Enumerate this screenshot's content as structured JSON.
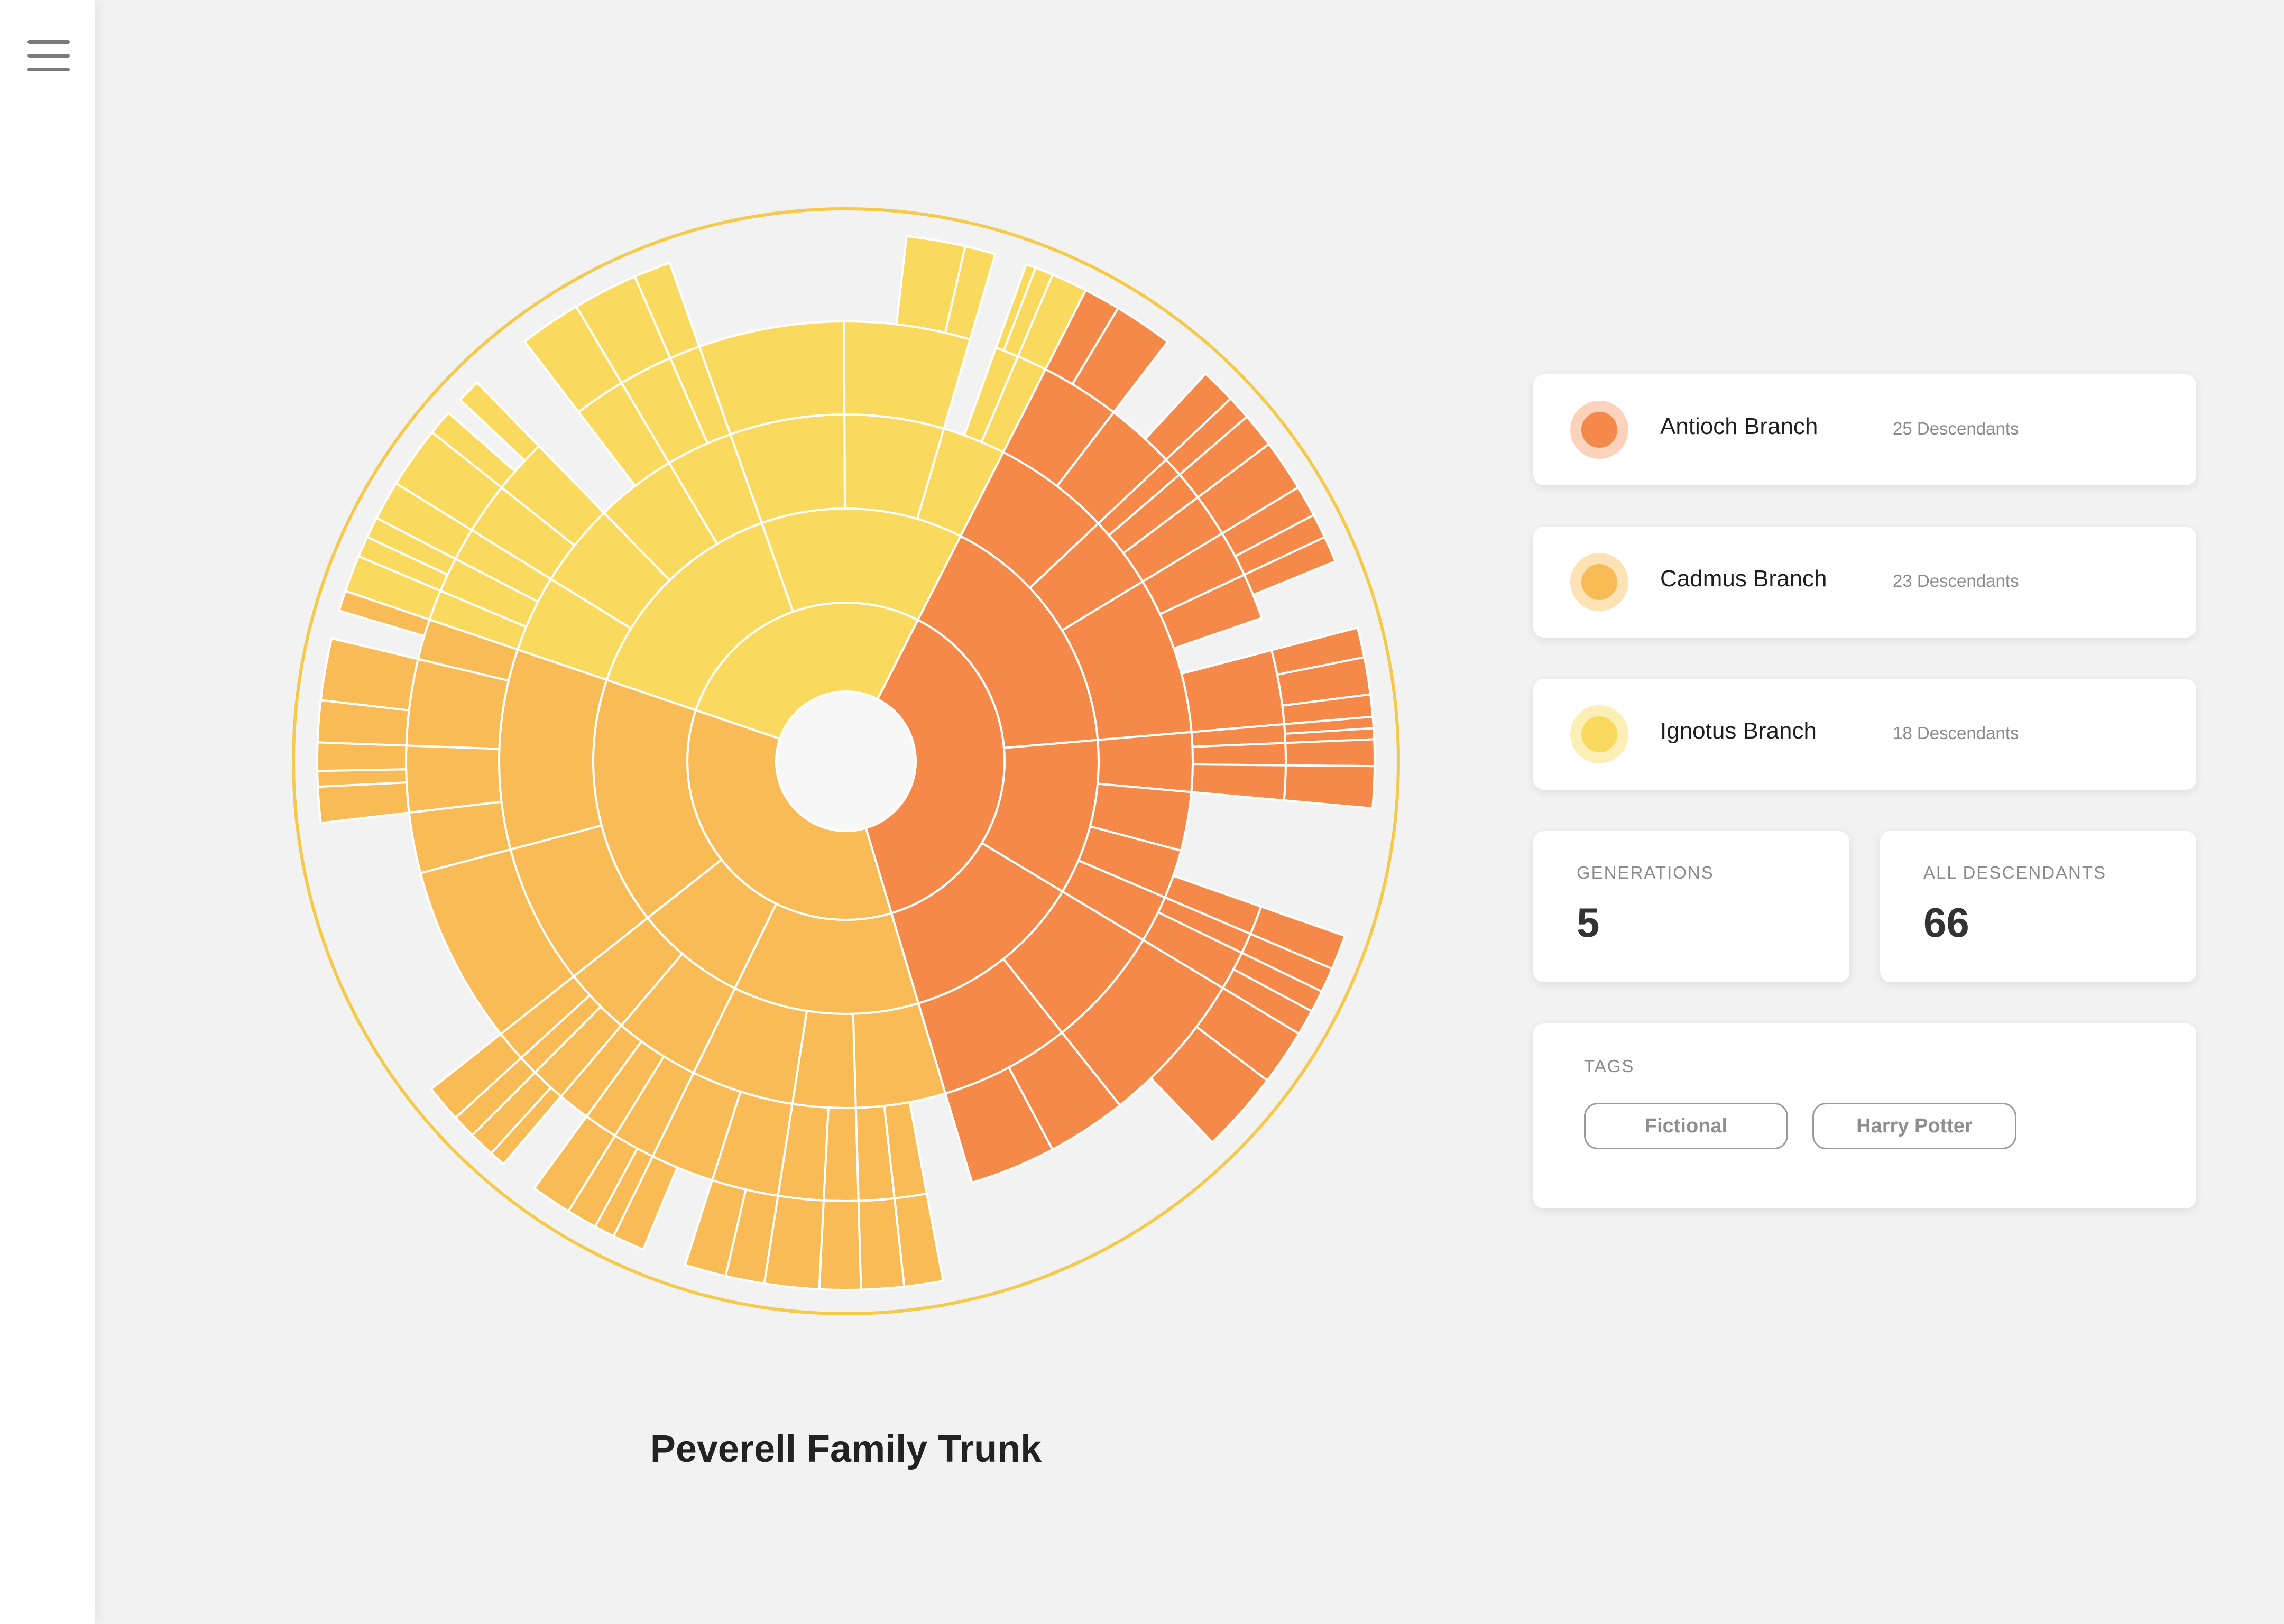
{
  "app": {
    "menu_icon": "hamburger-menu-icon"
  },
  "chart_data": {
    "type": "sunburst",
    "title": "Peverell Family Trunk",
    "generations": 5,
    "colors": {
      "Antioch Branch": "#f5894a",
      "Cadmus Branch": "#f9bb55",
      "Ignotus Branch": "#f9d95e",
      "ring": "#f5c94a"
    },
    "series": [
      {
        "name": "Antioch Branch",
        "descendants": 25
      },
      {
        "name": "Cadmus Branch",
        "descendants": 23
      },
      {
        "name": "Ignotus Branch",
        "descendants": 18
      }
    ]
  },
  "legend": [
    {
      "name": "Antioch Branch",
      "count": "25 Descendants",
      "color": "#f5894a",
      "halo": "#fbd2bb"
    },
    {
      "name": "Cadmus Branch",
      "count": "23 Descendants",
      "color": "#f9bb55",
      "halo": "#fde2b6"
    },
    {
      "name": "Ignotus Branch",
      "count": "18 Descendants",
      "color": "#f9d95e",
      "halo": "#fcefb5"
    }
  ],
  "stats": {
    "generations_label": "GENERATIONS",
    "generations_value": "5",
    "descendants_label": "ALL DESCENDANTS",
    "descendants_value": "66"
  },
  "tags": {
    "label": "TAGS",
    "items": [
      "Fictional",
      "Harry Potter"
    ]
  }
}
